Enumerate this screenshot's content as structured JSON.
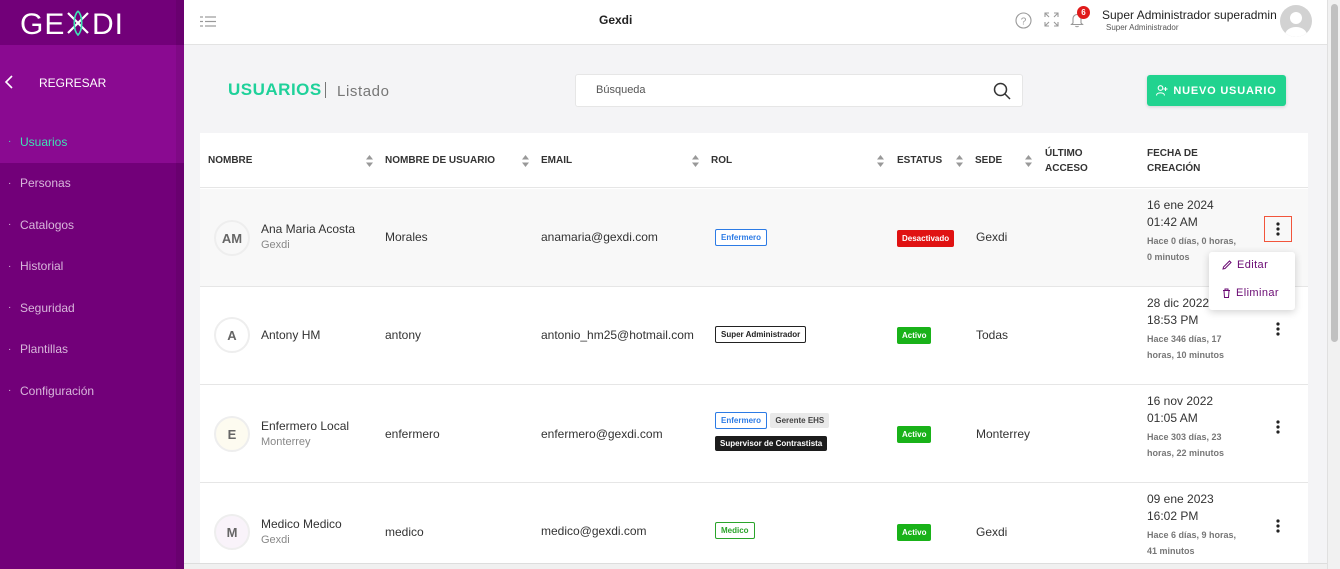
{
  "app": {
    "logo": "GEXDI",
    "title": "Gexdi"
  },
  "sidebar": {
    "back_label": "REGRESAR",
    "items": [
      {
        "label": "Usuarios",
        "active": true
      },
      {
        "label": "Personas"
      },
      {
        "label": "Catalogos"
      },
      {
        "label": "Historial"
      },
      {
        "label": "Seguridad"
      },
      {
        "label": "Plantillas"
      },
      {
        "label": "Configuración"
      }
    ]
  },
  "topbar": {
    "notifications": "6",
    "user_name": "Super Administrador superadmin",
    "user_role": "Super Administrador",
    "icons": [
      "menu-icon",
      "help-icon",
      "fullscreen-icon",
      "bell-icon"
    ]
  },
  "header": {
    "title": "USUARIOS",
    "subtitle": "Listado",
    "new_button": "NUEVO USUARIO"
  },
  "search": {
    "placeholder": "Búsqueda",
    "value": ""
  },
  "table": {
    "columns": [
      "NOMBRE",
      "NOMBRE DE USUARIO",
      "EMAIL",
      "ROL",
      "ESTATUS",
      "SEDE",
      "ÚLTIMO ACCESO",
      "FECHA DE CREACIÓN"
    ],
    "rows": [
      {
        "initials": "AM",
        "name": "Ana Maria Acosta",
        "org": "Gexdi",
        "username": "Morales",
        "email": "anamaria@gexdi.com",
        "roles": [
          "Enfermero"
        ],
        "status": "Desactivado",
        "sede": "Gexdi",
        "date": "16 ene 2024",
        "time": "01:42 AM",
        "ago": "Hace 0 días, 0 horas, 0 minutos"
      },
      {
        "initials": "A",
        "name": "Antony HM",
        "org": "",
        "username": "antony",
        "email": "antonio_hm25@hotmail.com",
        "roles": [
          "Super Administrador"
        ],
        "status": "Activo",
        "sede": "Todas",
        "date": "28 dic 2022",
        "time": "18:53 PM",
        "ago": "Hace 346 días, 17 horas, 10 minutos"
      },
      {
        "initials": "E",
        "name": "Enfermero Local",
        "org": "Monterrey",
        "username": "enfermero",
        "email": "enfermero@gexdi.com",
        "roles": [
          "Enfermero",
          "Gerente EHS",
          "Supervisor de Contrastista"
        ],
        "status": "Activo",
        "sede": "Monterrey",
        "date": "16 nov 2022",
        "time": "01:05 AM",
        "ago": "Hace 303 días, 23 horas, 22 minutos"
      },
      {
        "initials": "M",
        "name": "Medico Medico",
        "org": "Gexdi",
        "username": "medico",
        "email": "medico@gexdi.com",
        "roles": [
          "Medico"
        ],
        "status": "Activo",
        "sede": "Gexdi",
        "date": "09 ene 2023",
        "time": "16:02 PM",
        "ago": "Hace 6 días, 9 horas, 41 minutos"
      }
    ]
  },
  "row_menu": {
    "edit": "Editar",
    "delete": "Eliminar"
  }
}
